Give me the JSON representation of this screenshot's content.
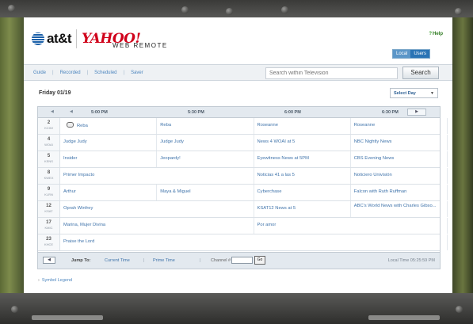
{
  "header": {
    "att_logo": "at&t",
    "yahoo_logo": "YAHOO!",
    "product_name": "WEB REMOTE",
    "help_label": "Help"
  },
  "view_toggle": {
    "local_label": "Local",
    "users_label": "Users"
  },
  "nav": {
    "links": [
      "Guide",
      "Recorded",
      "Scheduled",
      "Saver"
    ],
    "search_placeholder": "Search within Television",
    "search_button": "Search"
  },
  "date_label": "Friday 01/19",
  "select_day_label": "Select Day",
  "guide": {
    "times": [
      "5:00 PM",
      "5:30 PM",
      "6:00 PM",
      "6:30 PM"
    ],
    "rows": [
      {
        "num": "2",
        "call": "KCWI",
        "cells": [
          {
            "text": "Reba",
            "tv": true
          },
          {
            "text": "Reba"
          },
          {
            "text": "Roseanne"
          },
          {
            "text": "Roseanne"
          }
        ]
      },
      {
        "num": "4",
        "call": "WOAI",
        "cells": [
          {
            "text": "Judge Judy"
          },
          {
            "text": "Judge Judy"
          },
          {
            "text": "News 4 WOAI at 5"
          },
          {
            "text": "NBC Nightly News"
          }
        ]
      },
      {
        "num": "5",
        "call": "KENS",
        "cells": [
          {
            "text": "Insider"
          },
          {
            "text": "Jeopardy!"
          },
          {
            "text": "Eyewitness News at 5PM"
          },
          {
            "text": "CBS Evening News"
          }
        ]
      },
      {
        "num": "8",
        "call": "KWEX",
        "cells": [
          {
            "text": "Primer Impacto",
            "span": 2
          },
          {
            "text": "Noticias 41 a las 5"
          },
          {
            "text": "Noticiero Univisión"
          }
        ]
      },
      {
        "num": "9",
        "call": "KLRN",
        "cells": [
          {
            "text": "Arthur"
          },
          {
            "text": "Maya & Miguel"
          },
          {
            "text": "Cyberchase"
          },
          {
            "text": "Falcon with Ruth Ruffman"
          }
        ]
      },
      {
        "num": "12",
        "call": "KSAT",
        "cells": [
          {
            "text": "Oprah Winfrey",
            "span": 2
          },
          {
            "text": "KSAT12 News at 5"
          },
          {
            "text": "ABC's World News with Charles Gibso...",
            "two": true
          }
        ]
      },
      {
        "num": "17",
        "call": "KMIC",
        "cells": [
          {
            "text": "Marina, Mujer Divina",
            "span": 2
          },
          {
            "text": "Por amor",
            "span": 2
          }
        ]
      },
      {
        "num": "23",
        "call": "KHCE",
        "cells": [
          {
            "text": "Praise the Lord",
            "span": 4
          }
        ]
      }
    ]
  },
  "footer": {
    "prev_button": "◀",
    "jump_to_label": "Jump To:",
    "current_time_link": "Current Time",
    "prime_time_link": "Prime Time",
    "channel_label": "Channel #",
    "go_button": "Go",
    "local_time": "Local Time 05:25:59 PM"
  },
  "symbol_legend_link": "Symbol Legend"
}
